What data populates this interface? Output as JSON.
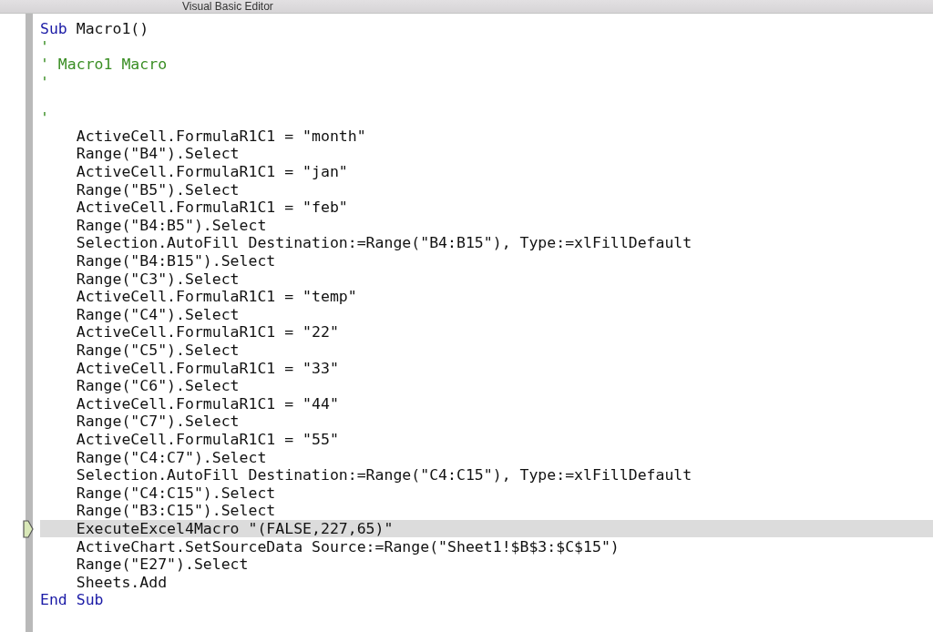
{
  "window": {
    "title": "Visual Basic Editor"
  },
  "code": {
    "lines": [
      {
        "kind": "keyword",
        "keyword": "Sub",
        "text": " Macro1()",
        "current": false
      },
      {
        "kind": "comment",
        "text": "'",
        "current": false
      },
      {
        "kind": "comment",
        "text": "' Macro1 Macro",
        "current": false
      },
      {
        "kind": "comment",
        "text": "'",
        "current": false
      },
      {
        "kind": "blank"
      },
      {
        "kind": "comment",
        "text": "'",
        "current": false
      },
      {
        "kind": "code",
        "text": "    ActiveCell.FormulaR1C1 = \"month\"",
        "current": false
      },
      {
        "kind": "code",
        "text": "    Range(\"B4\").Select",
        "current": false
      },
      {
        "kind": "code",
        "text": "    ActiveCell.FormulaR1C1 = \"jan\"",
        "current": false
      },
      {
        "kind": "code",
        "text": "    Range(\"B5\").Select",
        "current": false
      },
      {
        "kind": "code",
        "text": "    ActiveCell.FormulaR1C1 = \"feb\"",
        "current": false
      },
      {
        "kind": "code",
        "text": "    Range(\"B4:B5\").Select",
        "current": false
      },
      {
        "kind": "code",
        "text": "    Selection.AutoFill Destination:=Range(\"B4:B15\"), Type:=xlFillDefault",
        "current": false
      },
      {
        "kind": "code",
        "text": "    Range(\"B4:B15\").Select",
        "current": false
      },
      {
        "kind": "code",
        "text": "    Range(\"C3\").Select",
        "current": false
      },
      {
        "kind": "code",
        "text": "    ActiveCell.FormulaR1C1 = \"temp\"",
        "current": false
      },
      {
        "kind": "code",
        "text": "    Range(\"C4\").Select",
        "current": false
      },
      {
        "kind": "code",
        "text": "    ActiveCell.FormulaR1C1 = \"22\"",
        "current": false
      },
      {
        "kind": "code",
        "text": "    Range(\"C5\").Select",
        "current": false
      },
      {
        "kind": "code",
        "text": "    ActiveCell.FormulaR1C1 = \"33\"",
        "current": false
      },
      {
        "kind": "code",
        "text": "    Range(\"C6\").Select",
        "current": false
      },
      {
        "kind": "code",
        "text": "    ActiveCell.FormulaR1C1 = \"44\"",
        "current": false
      },
      {
        "kind": "code",
        "text": "    Range(\"C7\").Select",
        "current": false
      },
      {
        "kind": "code",
        "text": "    ActiveCell.FormulaR1C1 = \"55\"",
        "current": false
      },
      {
        "kind": "code",
        "text": "    Range(\"C4:C7\").Select",
        "current": false
      },
      {
        "kind": "code",
        "text": "    Selection.AutoFill Destination:=Range(\"C4:C15\"), Type:=xlFillDefault",
        "current": false
      },
      {
        "kind": "code",
        "text": "    Range(\"C4:C15\").Select",
        "current": false
      },
      {
        "kind": "code",
        "text": "    Range(\"B3:C15\").Select",
        "current": false
      },
      {
        "kind": "code",
        "text": "    ExecuteExcel4Macro \"(FALSE,227,65)\"",
        "current": true
      },
      {
        "kind": "code",
        "text": "    ActiveChart.SetSourceData Source:=Range(\"Sheet1!$B$3:$C$15\")",
        "current": false
      },
      {
        "kind": "code",
        "text": "    Range(\"E27\").Select",
        "current": false
      },
      {
        "kind": "code",
        "text": "    Sheets.Add",
        "current": false
      },
      {
        "kind": "keyword",
        "keyword": "End Sub",
        "current": false
      }
    ]
  }
}
